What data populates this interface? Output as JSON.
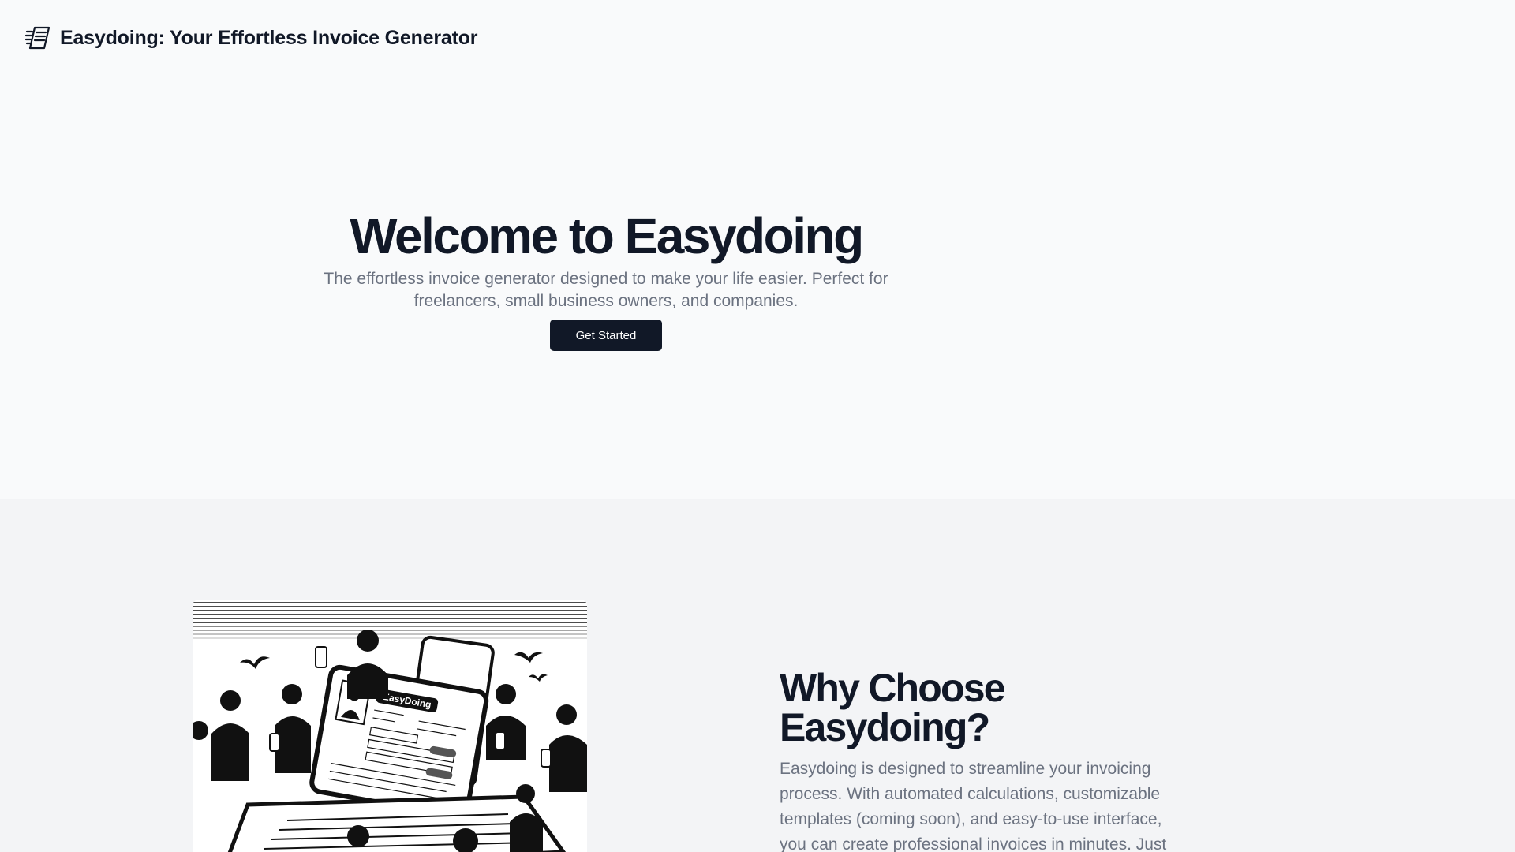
{
  "header": {
    "logo_icon": "invoice-logo-icon",
    "title": "Easydoing: Your Effortless Invoice Generator"
  },
  "hero": {
    "title": "Welcome to Easydoing",
    "subtitle": "The effortless invoice generator designed to make your life easier. Perfect for freelancers, small business owners, and companies.",
    "cta_label": "Get Started"
  },
  "features": {
    "illustration_brand": "EasyDoing",
    "title": "Why Choose Easydoing?",
    "body": "Easydoing is designed to streamline your invoicing process. With automated calculations, customizable templates (coming soon), and easy-to-use interface, you can create professional invoices in minutes. Just"
  },
  "colors": {
    "page_bg": "#f9fafb",
    "section_bg": "#f3f4f6",
    "text_primary": "#111827",
    "text_muted": "#6b7280",
    "button_bg": "#111827",
    "button_text": "#ffffff"
  }
}
